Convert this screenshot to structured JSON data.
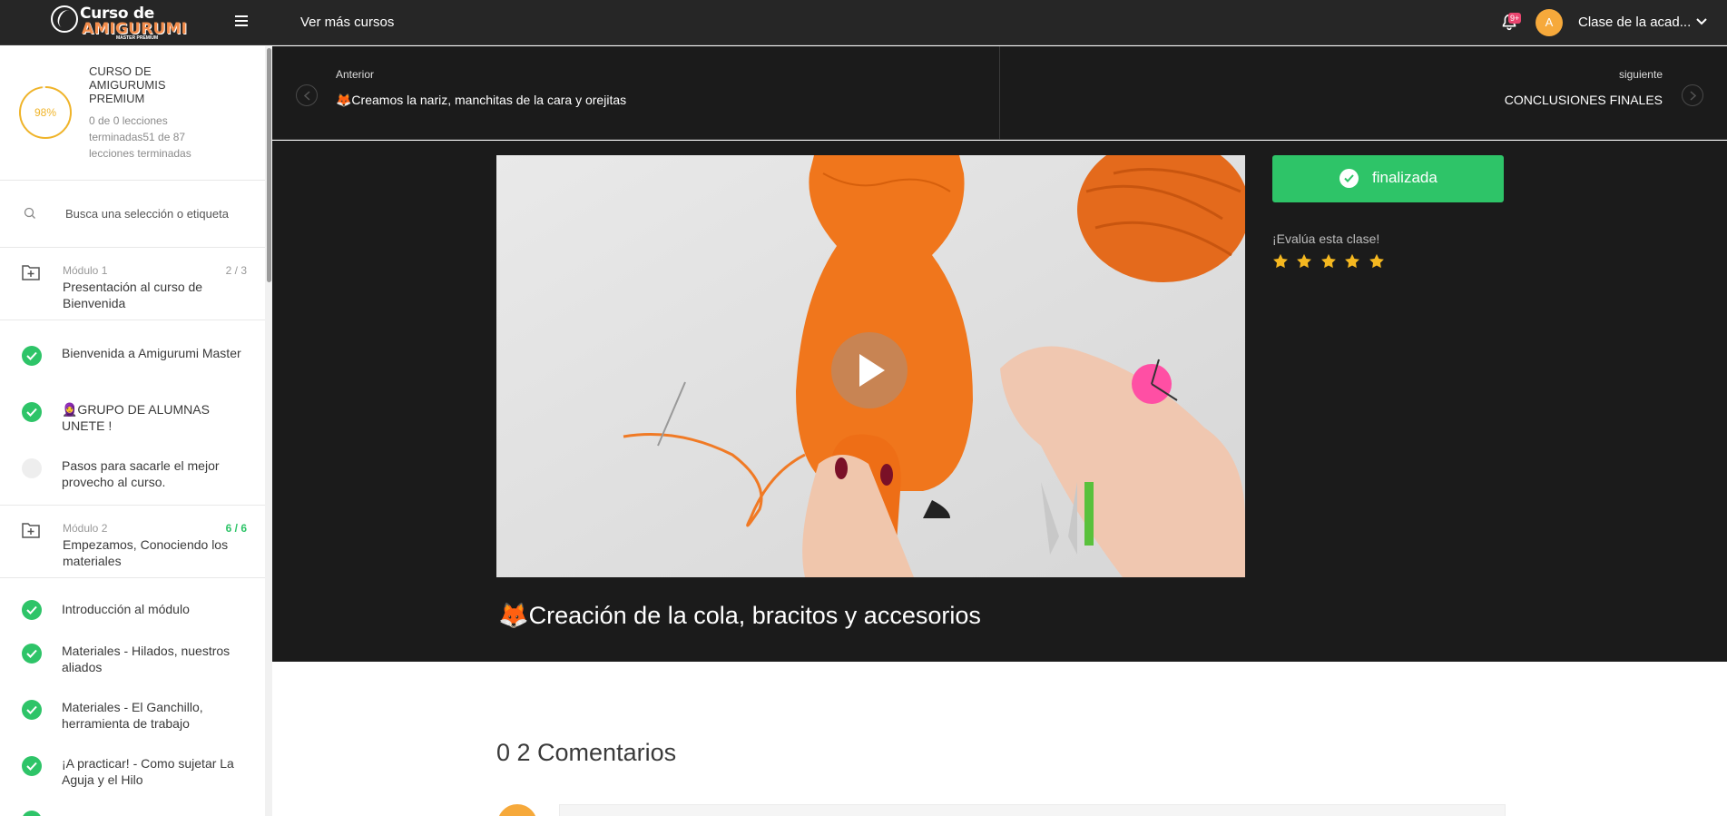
{
  "header": {
    "logo": {
      "line1": "Curso de",
      "line2": "AMIGURUMI",
      "line3": "MASTER PREMIUM"
    },
    "more_courses": "Ver más cursos",
    "notifications_badge": "9+",
    "avatar_initial": "A",
    "user_name": "Clase de la acad..."
  },
  "sidebar": {
    "progress_percent": "98%",
    "progress_value": 0.98,
    "course_title": "CURSO DE AMIGURUMIS PREMIUM",
    "course_status": "0 de 0 lecciones terminadas51 de 87 lecciones terminadas",
    "search_placeholder": "Busca una selección o etiqueta",
    "modules": [
      {
        "number": "Módulo 1",
        "count": "2 / 3",
        "name": "Presentación al curso de Bienvenida"
      },
      {
        "number": "Módulo 2",
        "count": "6 / 6",
        "name": "Empezamos, Conociendo los materiales"
      }
    ],
    "lessons_m1": [
      {
        "name": "Bienvenida a Amigurumi Master",
        "done": true
      },
      {
        "name": "🧕GRUPO DE ALUMNAS UNETE !",
        "done": true
      },
      {
        "name": "Pasos para sacarle el mejor provecho al curso.",
        "done": false
      }
    ],
    "lessons_m2": [
      {
        "name": "Introducción al módulo",
        "done": true
      },
      {
        "name": "Materiales - Hilados, nuestros aliados",
        "done": true
      },
      {
        "name": "Materiales - El Ganchillo, herramienta de trabajo",
        "done": true
      },
      {
        "name": "¡A practicar! - Como sujetar La Aguja y el Hilo",
        "done": true
      }
    ]
  },
  "navigation": {
    "prev_label": "Anterior",
    "prev_title": "🦊Creamos la nariz, manchitas de la cara y orejitas",
    "next_label": "siguiente",
    "next_title": "CONCLUSIONES FINALES"
  },
  "lesson": {
    "title": "🦊Creación de la cola, bracitos y accesorios",
    "finish_label": "finalizada",
    "rate_label": "¡Evalúa esta clase!",
    "rating": 5
  },
  "comments": {
    "title": "0 2 Comentarios"
  },
  "colors": {
    "accent_green": "#2ec468",
    "progress_yellow": "#f0b429",
    "avatar_orange": "#f6a93b",
    "dark_bg": "#1b1b1b",
    "header_bg": "#262626"
  }
}
